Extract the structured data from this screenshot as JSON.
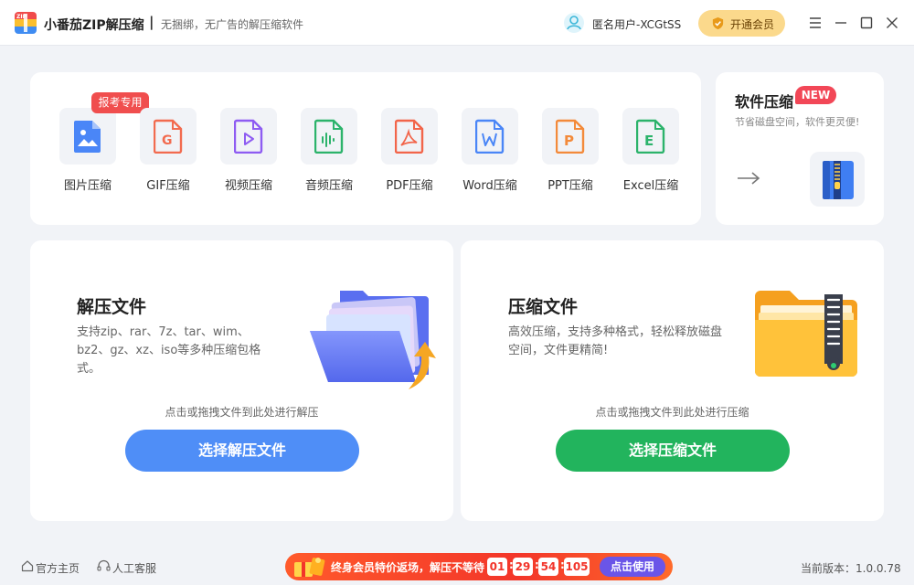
{
  "titlebar": {
    "app_title": "小番茄ZIP解压缩",
    "separator": "|",
    "slogan": "无捆绑，无广告的解压缩软件",
    "logo_icon": "zip-logo-icon",
    "user_name": "匿名用户-XCGtSS",
    "vip_label": "开通会员",
    "window_icons": [
      "menu-icon",
      "minimize-icon",
      "maximize-icon",
      "close-icon"
    ]
  },
  "tools": {
    "badge": "报考专用",
    "items": [
      {
        "label": "图片压缩",
        "icon": "image-file-icon",
        "color": "#4a86f7"
      },
      {
        "label": "GIF压缩",
        "icon": "gif-file-icon",
        "color": "#f26b4f"
      },
      {
        "label": "视频压缩",
        "icon": "video-file-icon",
        "color": "#8e5cf2"
      },
      {
        "label": "音频压缩",
        "icon": "audio-file-icon",
        "color": "#2cb36b"
      },
      {
        "label": "PDF压缩",
        "icon": "pdf-file-icon",
        "color": "#f2654a"
      },
      {
        "label": "Word压缩",
        "icon": "word-file-icon",
        "color": "#4a86f7"
      },
      {
        "label": "PPT压缩",
        "icon": "ppt-file-icon",
        "color": "#f38a3a"
      },
      {
        "label": "Excel压缩",
        "icon": "excel-file-icon",
        "color": "#2cb36b"
      }
    ]
  },
  "software_compress": {
    "title": "软件压缩",
    "badge": "NEW",
    "desc": "节省磁盘空间，软件更灵便!",
    "arrow_icon": "arrow-right-icon",
    "zip_icon": "zip-book-icon"
  },
  "extract": {
    "title": "解压文件",
    "desc": "支持zip、rar、7z、tar、wim、bz2、gz、xz、iso等多种压缩包格式。",
    "hint": "点击或拖拽文件到此处进行解压",
    "button": "选择解压文件",
    "color": "#4f8ef7"
  },
  "compress": {
    "title": "压缩文件",
    "desc": "高效压缩，支持多种格式，轻松释放磁盘空间，文件更精简!",
    "hint": "点击或拖拽文件到此处进行压缩",
    "button": "选择压缩文件",
    "color": "#22b45d"
  },
  "footer": {
    "home": "官方主页",
    "support": "人工客服",
    "promo_text": "终身会员特价返场，解压不等待",
    "countdown": [
      "01",
      "29",
      "54",
      "105"
    ],
    "promo_button": "点击使用",
    "version": "当前版本：1.0.0.78"
  }
}
